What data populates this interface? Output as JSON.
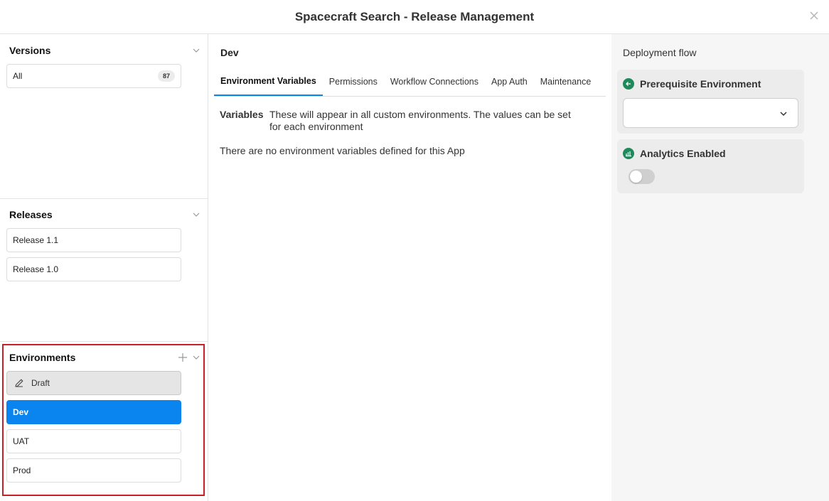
{
  "window": {
    "title": "Spacecraft Search - Release Management"
  },
  "versions": {
    "title": "Versions",
    "items": [
      {
        "label": "All",
        "count": "87"
      }
    ]
  },
  "releases": {
    "title": "Releases",
    "items": [
      {
        "label": "Release 1.1"
      },
      {
        "label": "Release 1.0"
      }
    ]
  },
  "environments": {
    "title": "Environments",
    "items": [
      {
        "label": "Draft",
        "icon": "pencil-icon"
      },
      {
        "label": "Dev",
        "selected": true
      },
      {
        "label": "UAT"
      },
      {
        "label": "Prod"
      }
    ]
  },
  "main": {
    "env_name": "Dev",
    "tabs": [
      {
        "label": "Environment Variables",
        "active": true
      },
      {
        "label": "Permissions"
      },
      {
        "label": "Workflow Connections"
      },
      {
        "label": "App Auth"
      },
      {
        "label": "Maintenance"
      }
    ],
    "variables_label": "Variables",
    "variables_description": "These will appear in all custom environments. The values can be set for each environment",
    "empty_message": "There are no environment variables defined for this App"
  },
  "deployment": {
    "title": "Deployment flow",
    "prerequisite": {
      "label": "Prerequisite Environment",
      "value": ""
    },
    "analytics": {
      "label": "Analytics Enabled",
      "enabled": false
    }
  },
  "colors": {
    "accent": "#0a84ee",
    "highlight": "#c8202a",
    "icon_green": "#1e8a5a"
  }
}
